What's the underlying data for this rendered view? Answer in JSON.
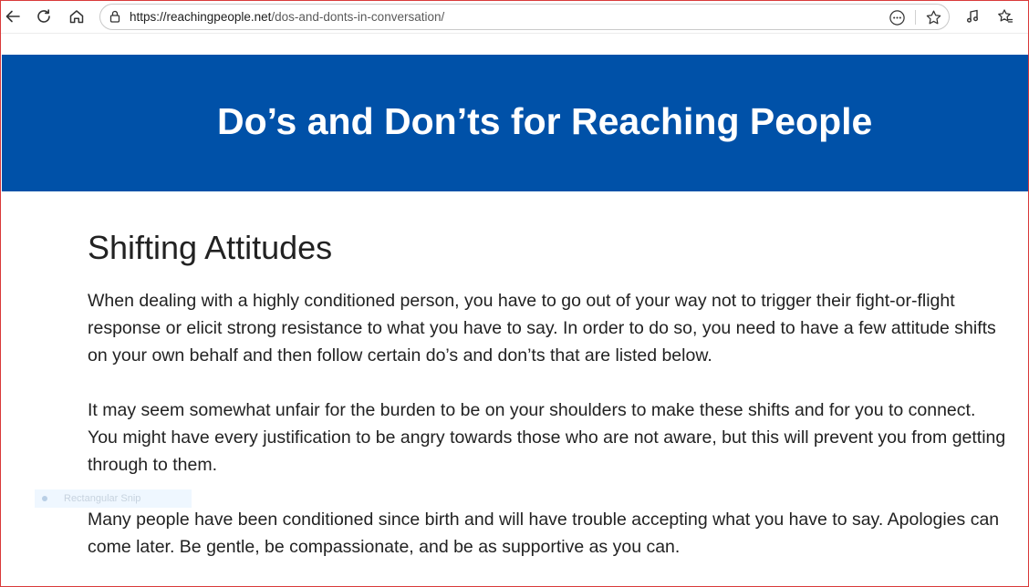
{
  "browser": {
    "url_host": "https://reachingpeople.net",
    "url_path": "/dos-and-donts-in-conversation/"
  },
  "page": {
    "banner_title": "Do’s and Don’ts for Reaching People",
    "heading": "Shifting Attitudes",
    "paragraphs": [
      "When dealing with a highly conditioned person, you have to go out of your way not to trigger their fight-or-flight response or elicit strong resistance to what you have to say. In order to do so, you need to have a few attitude shifts on your own behalf and then follow certain do’s and don’ts that are listed below.",
      "It may seem somewhat unfair for the burden to be on your shoulders to make these shifts and for you to connect. You might have every justification to be angry towards those who are not aware, but this will prevent you from getting through to them.",
      "Many people have been conditioned since birth and will have trouble accepting what you have to say. Apologies can come later. Be gentle, be compassionate, and be as supportive as you can."
    ]
  },
  "overlay": {
    "snip_label": "Rectangular Snip"
  },
  "colors": {
    "banner": "#0051a8",
    "window_border": "#d93a3a"
  }
}
